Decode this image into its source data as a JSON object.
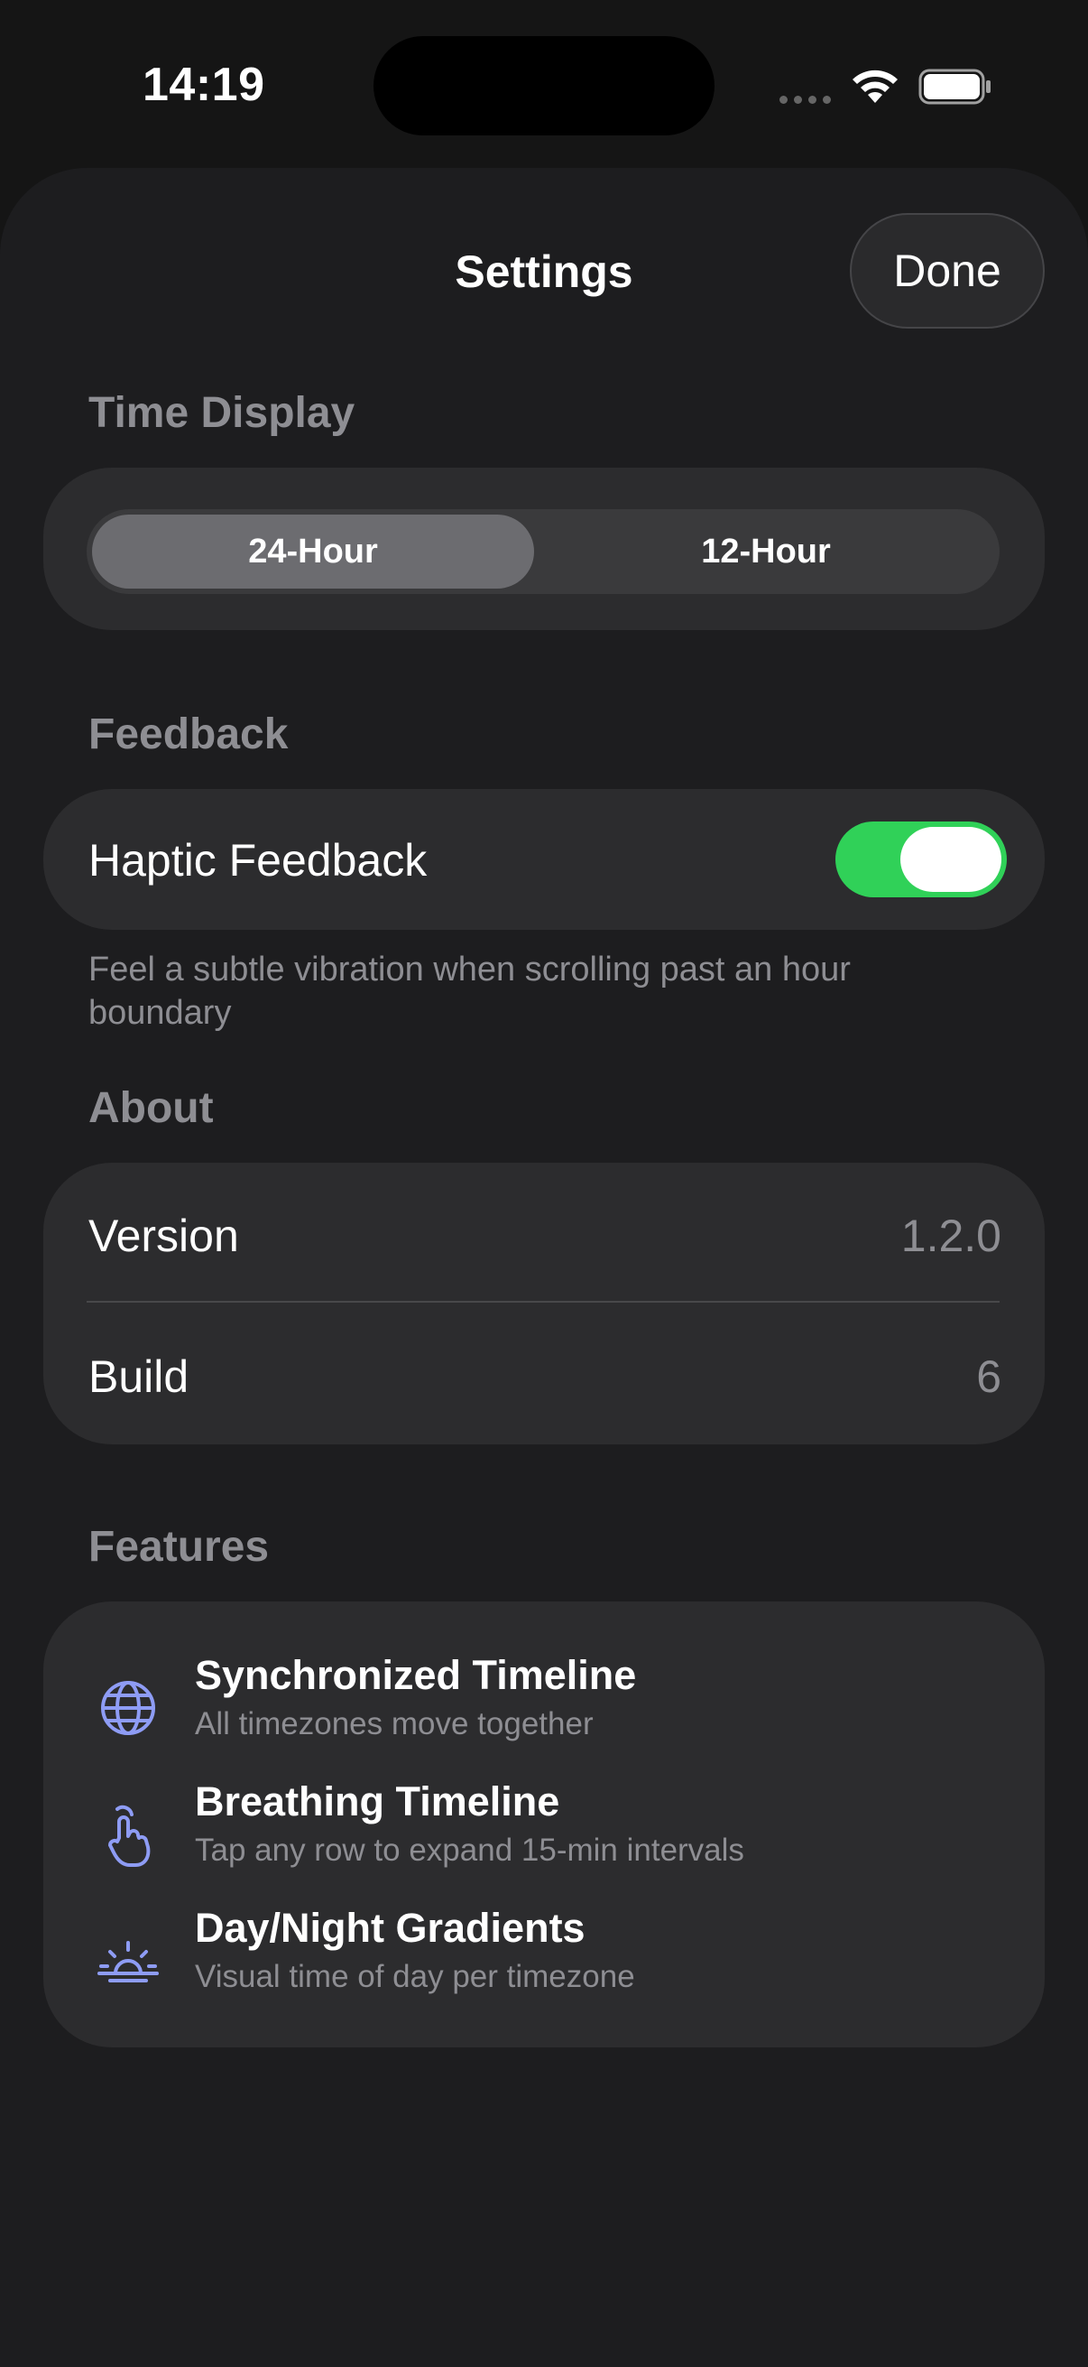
{
  "status_bar": {
    "time": "14:19"
  },
  "nav": {
    "title": "Settings",
    "done_label": "Done"
  },
  "time_display": {
    "header": "Time Display",
    "options": [
      "24-Hour",
      "12-Hour"
    ],
    "selected": "24-Hour"
  },
  "feedback": {
    "header": "Feedback",
    "haptic_label": "Haptic Feedback",
    "haptic_on": true,
    "footer": "Feel a subtle vibration when scrolling past an hour boundary"
  },
  "about": {
    "header": "About",
    "rows": [
      {
        "label": "Version",
        "value": "1.2.0"
      },
      {
        "label": "Build",
        "value": "6"
      }
    ]
  },
  "features": {
    "header": "Features",
    "items": [
      {
        "icon": "globe-icon",
        "title": "Synchronized Timeline",
        "subtitle": "All timezones move together"
      },
      {
        "icon": "hand-tap-icon",
        "title": "Breathing Timeline",
        "subtitle": "Tap any row to expand 15-min intervals"
      },
      {
        "icon": "sunrise-icon",
        "title": "Day/Night Gradients",
        "subtitle": "Visual time of day per timezone"
      }
    ]
  },
  "colors": {
    "accent_icon": "#8e9cf5",
    "toggle_on": "#30d158",
    "background": "#1d1d1f",
    "card": "#2c2c2e"
  }
}
